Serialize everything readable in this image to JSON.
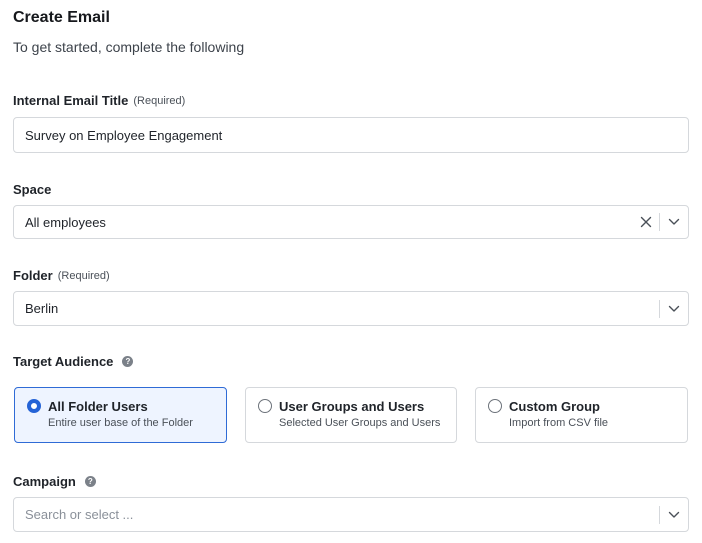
{
  "header": {
    "title": "Create Email",
    "subtitle": "To get started, complete the following"
  },
  "email_title": {
    "label": "Internal Email Title",
    "required": "(Required)",
    "value": "Survey on Employee Engagement"
  },
  "space": {
    "label": "Space",
    "value": "All employees"
  },
  "folder": {
    "label": "Folder",
    "required": "(Required)",
    "value": "Berlin"
  },
  "audience": {
    "label": "Target Audience",
    "help_icon": "?",
    "selected": "all-folder-users",
    "options": [
      {
        "title": "All Folder Users",
        "description": "Entire user base of the Folder"
      },
      {
        "title": "User Groups and Users",
        "description": "Selected User Groups and Users"
      },
      {
        "title": "Custom Group",
        "description": "Import from CSV file"
      }
    ]
  },
  "campaign": {
    "label": "Campaign",
    "help_icon": "?",
    "placeholder": "Search or select ..."
  },
  "colors": {
    "accent": "#2563d6",
    "selected_bg": "#eef4ff",
    "border": "#d5d8dc"
  }
}
